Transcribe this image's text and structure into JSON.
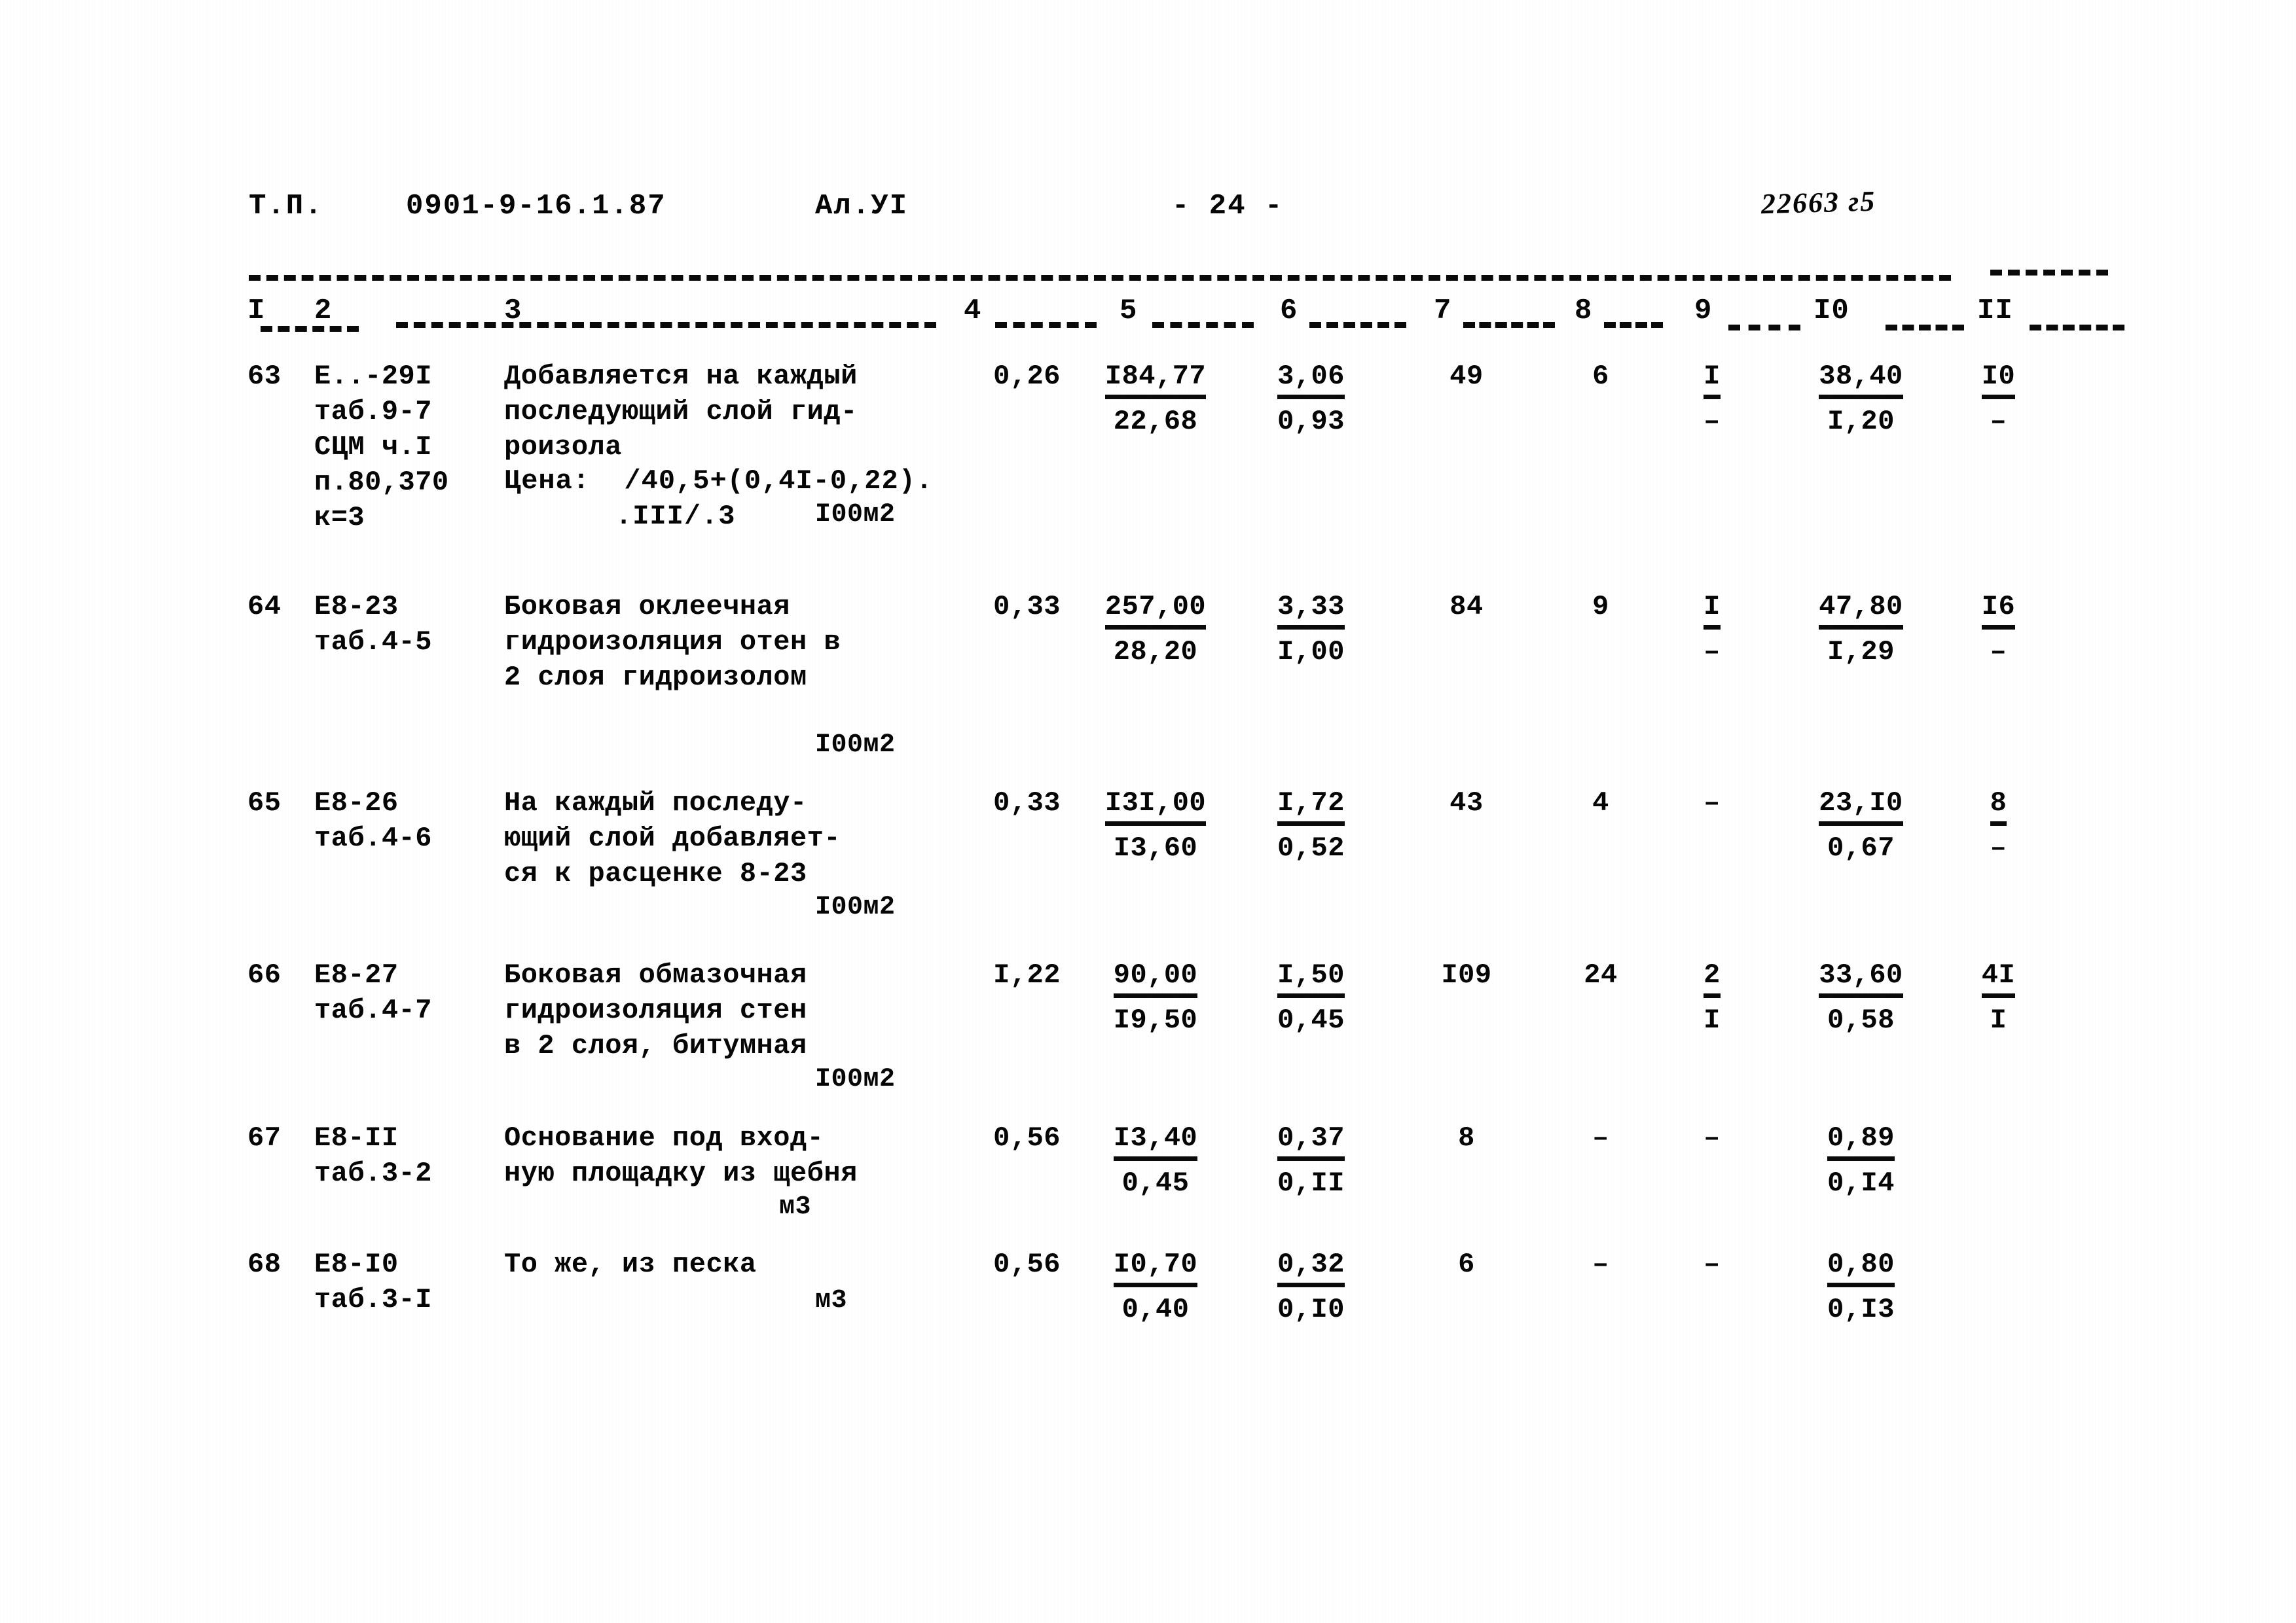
{
  "header": {
    "type_label": "Т.П.",
    "project_code": "0901-9-16.1.87",
    "album": "Ал.УI",
    "page_number": "- 24 -",
    "stamp": "22663 г5"
  },
  "table": {
    "column_numbers": [
      "I",
      "2",
      "3",
      "4",
      "5",
      "6",
      "7",
      "8",
      "9",
      "I0",
      "II"
    ],
    "rows": [
      {
        "num": "63",
        "code_lines": [
          "Е..-29I",
          "таб.9-7",
          "СЦМ ч.I",
          "п.80,370",
          "к=3"
        ],
        "desc_lines": [
          "Добавляется на каждый",
          "последующий слой гид-",
          "роизола"
        ],
        "price_note_lines": [
          "Цена:  /40,5+(0,4I-0,22).",
          ".III/.3"
        ],
        "unit": "I00м2",
        "col4": "0,26",
        "col5_top": "I84,77",
        "col5_bot": "22,68",
        "col6_top": "3,06",
        "col6_bot": "0,93",
        "col7": "49",
        "col8": "6",
        "col9_top": "I",
        "col9_bot": "–",
        "col10_top": "38,40",
        "col10_bot": "I,20",
        "col11_top": "I0",
        "col11_bot": "–"
      },
      {
        "num": "64",
        "code_lines": [
          "Е8-23",
          "таб.4-5"
        ],
        "desc_lines": [
          "Боковая оклеечная",
          "гидроизоляция отен в",
          "2 слоя гидроизолом"
        ],
        "price_note_lines": [],
        "unit": "I00м2",
        "col4": "0,33",
        "col5_top": "257,00",
        "col5_bot": "28,20",
        "col6_top": "3,33",
        "col6_bot": "I,00",
        "col7": "84",
        "col8": "9",
        "col9_top": "I",
        "col9_bot": "–",
        "col10_top": "47,80",
        "col10_bot": "I,29",
        "col11_top": "I6",
        "col11_bot": "–"
      },
      {
        "num": "65",
        "code_lines": [
          "Е8-26",
          "таб.4-6"
        ],
        "desc_lines": [
          "На каждый последу-",
          "ющий слой добавляет-",
          "ся к расценке 8-23"
        ],
        "price_note_lines": [],
        "unit": "I00м2",
        "col4": "0,33",
        "col5_top": "I3I,00",
        "col5_bot": "I3,60",
        "col6_top": "I,72",
        "col6_bot": "0,52",
        "col7": "43",
        "col8": "4",
        "col9_top": "–",
        "col9_bot": "",
        "col10_top": "23,I0",
        "col10_bot": "0,67",
        "col11_top": "8",
        "col11_bot": "–"
      },
      {
        "num": "66",
        "code_lines": [
          "Е8-27",
          "таб.4-7"
        ],
        "desc_lines": [
          "Боковая обмазочная",
          "гидроизоляция стен",
          "в 2 слоя, битумная"
        ],
        "price_note_lines": [],
        "unit": "I00м2",
        "col4": "I,22",
        "col5_top": "90,00",
        "col5_bot": "I9,50",
        "col6_top": "I,50",
        "col6_bot": "0,45",
        "col7": "I09",
        "col8": "24",
        "col9_top": "2",
        "col9_bot": "I",
        "col10_top": "33,60",
        "col10_bot": "0,58",
        "col11_top": "4I",
        "col11_bot": "I"
      },
      {
        "num": "67",
        "code_lines": [
          "Е8-II",
          "таб.3-2"
        ],
        "desc_lines": [
          "Основание под вход-",
          "ную площадку из щебня"
        ],
        "price_note_lines": [],
        "unit": "м3",
        "col4": "0,56",
        "col5_top": "I3,40",
        "col5_bot": "0,45",
        "col6_top": "0,37",
        "col6_bot": "0,II",
        "col7": "8",
        "col8": "–",
        "col9_top": "–",
        "col9_bot": "",
        "col10_top": "0,89",
        "col10_bot": "0,I4",
        "col11_top": "",
        "col11_bot": ""
      },
      {
        "num": "68",
        "code_lines": [
          "Е8-I0",
          "таб.3-I"
        ],
        "desc_lines": [
          "То же, из песка"
        ],
        "price_note_lines": [],
        "unit": "м3",
        "col4": "0,56",
        "col5_top": "I0,70",
        "col5_bot": "0,40",
        "col6_top": "0,32",
        "col6_bot": "0,I0",
        "col7": "6",
        "col8": "–",
        "col9_top": "–",
        "col9_bot": "",
        "col10_top": "0,80",
        "col10_bot": "0,I3",
        "col11_top": "",
        "col11_bot": ""
      }
    ]
  }
}
